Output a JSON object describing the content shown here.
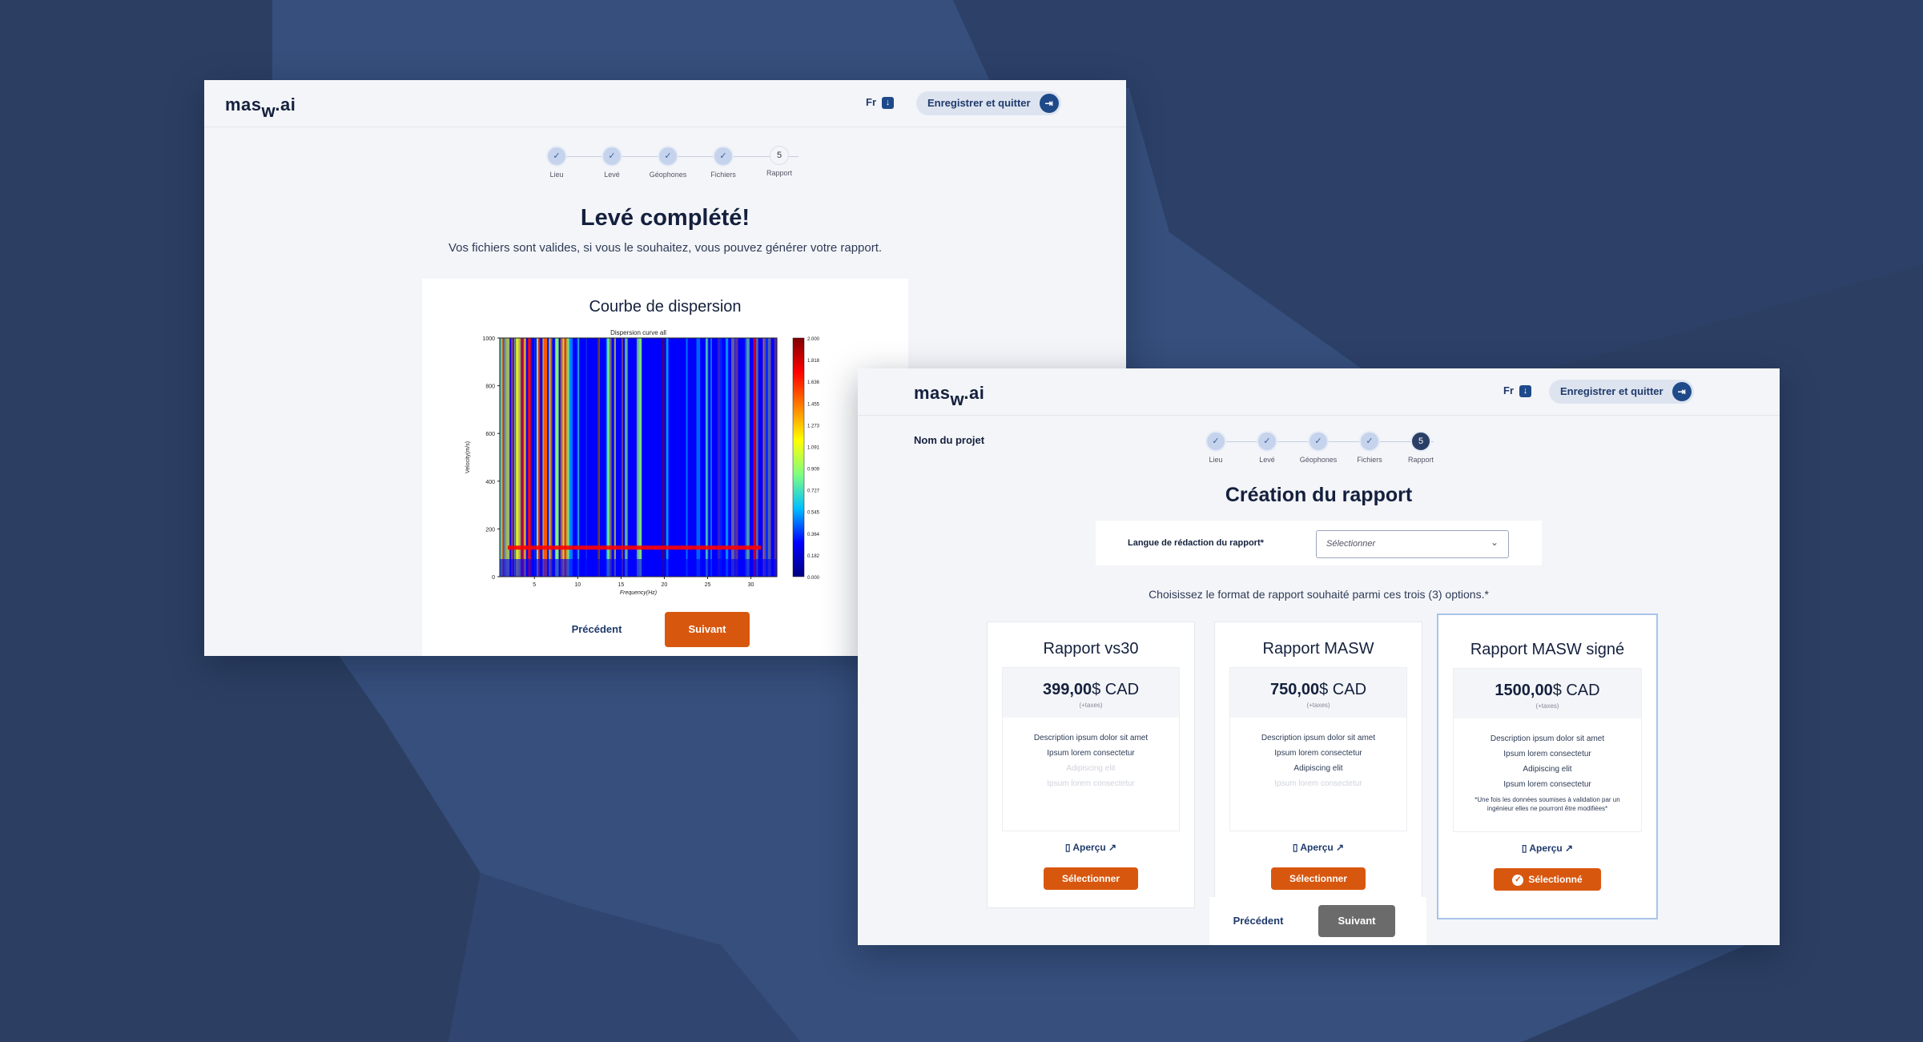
{
  "brand": {
    "logo_main": "mas",
    "logo_sub": "w",
    "logo_end": ".ai"
  },
  "header": {
    "lang": "Fr",
    "save_label": "Enregistrer et quitter"
  },
  "steps": [
    "Lieu",
    "Levé",
    "Géophones",
    "Fichiers",
    "Rapport"
  ],
  "step_last_number": "5",
  "window1": {
    "title": "Levé complété!",
    "subtitle": "Vos fichiers sont valides, si vous le souhaitez, vous pouvez générer votre rapport.",
    "chart_heading": "Courbe de dispersion",
    "prev_label": "Précédent",
    "next_label": "Suivant"
  },
  "chart_data": {
    "type": "heatmap",
    "title": "Dispersion curve all",
    "xlabel": "Frequency(Hz)",
    "ylabel": "Velocity(m/s)",
    "x_ticks": [
      "5",
      "10",
      "15",
      "20",
      "25",
      "30"
    ],
    "y_ticks": [
      "0",
      "200",
      "400",
      "600",
      "800",
      "1000"
    ],
    "colorbar_ticks": [
      "0.000",
      "0.182",
      "0.364",
      "0.545",
      "0.727",
      "0.909",
      "1.091",
      "1.273",
      "1.455",
      "1.636",
      "1.818",
      "2.000"
    ],
    "xlim": [
      1,
      33
    ],
    "ylim": [
      0,
      1000
    ],
    "colormap": [
      "#00007f",
      "#0000ff",
      "#00bfff",
      "#7fff7f",
      "#ffff00",
      "#ff7f00",
      "#ff0000",
      "#7f0000"
    ]
  },
  "window2": {
    "project_label": "Nom du projet",
    "title": "Création du rapport",
    "lang_label": "Langue de rédaction du rapport*",
    "lang_placeholder": "Sélectionner",
    "instruction": "Choisissez le format de rapport souhaité parmi ces trois (3) options.*",
    "prev_label": "Précédent",
    "next_label": "Suivant",
    "cards": [
      {
        "title": "Rapport vs30",
        "price_bold": "399,00",
        "price_unit": "$ CAD",
        "tax": "(+taxes)",
        "lines": [
          "Description ipsum dolor sit amet",
          "Ipsum lorem consectetur",
          "Adipiscing elit",
          "Ipsum lorem consectetur"
        ],
        "faint_from": 2,
        "apercu": "Aperçu",
        "button": "Sélectionner"
      },
      {
        "title": "Rapport MASW",
        "price_bold": "750,00",
        "price_unit": "$ CAD",
        "tax": "(+taxes)",
        "lines": [
          "Description ipsum dolor sit amet",
          "Ipsum lorem consectetur",
          "Adipiscing elit",
          "Ipsum lorem consectetur"
        ],
        "faint_from": 3,
        "apercu": "Aperçu",
        "button": "Sélectionner"
      },
      {
        "title": "Rapport MASW signé",
        "price_bold": "1500,00",
        "price_unit": "$ CAD",
        "tax": "(+taxes)",
        "lines": [
          "Description ipsum dolor sit amet",
          "Ipsum lorem consectetur",
          "Adipiscing elit",
          "Ipsum lorem consectetur"
        ],
        "faint_from": 4,
        "note": "*Une fois les données soumises à validation par un ingénieur elles ne pourront être modifiées*",
        "apercu": "Aperçu",
        "button": "Sélectionné"
      }
    ]
  },
  "colors": {
    "background": "#2c3f63",
    "accent": "#d8570f",
    "navy": "#14203d",
    "step_done": "#c5d3ec"
  }
}
